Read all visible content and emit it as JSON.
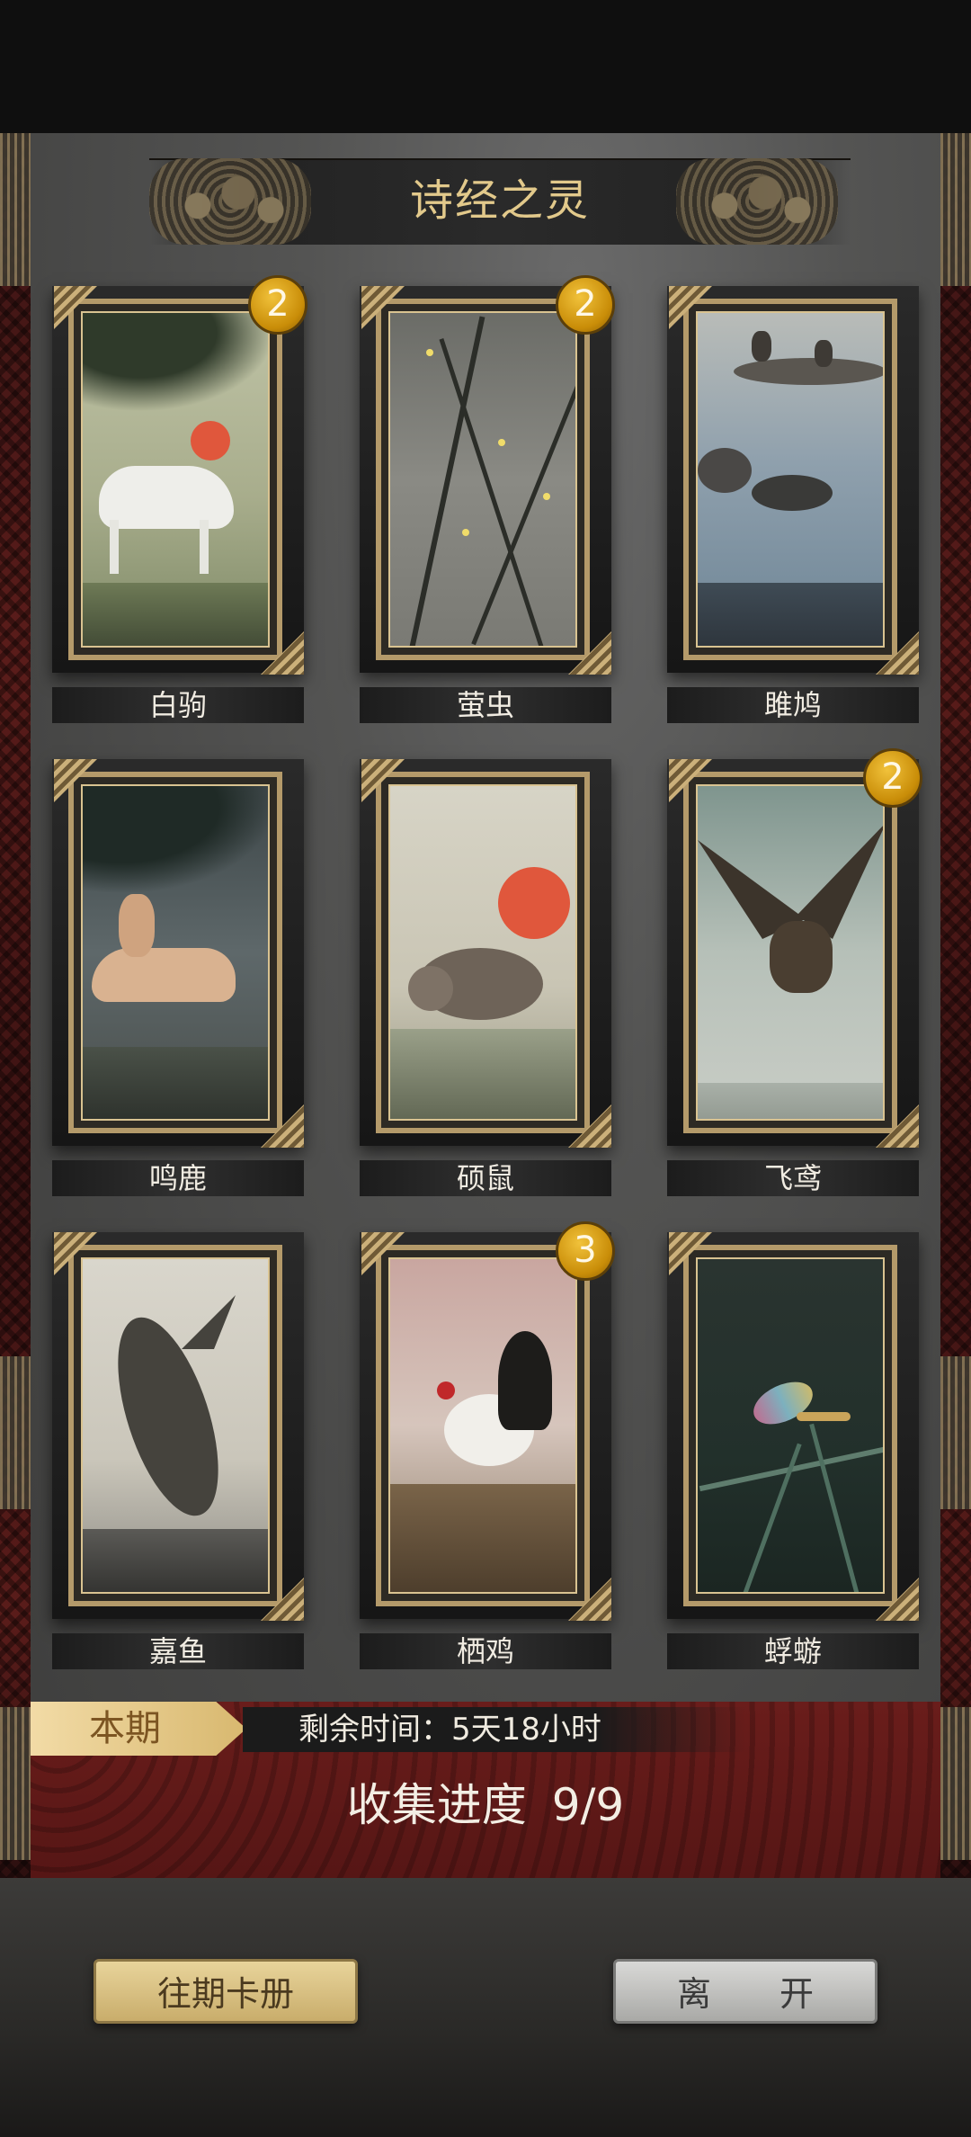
{
  "title": "诗经之灵",
  "cards": [
    {
      "name": "白驹",
      "count": "2"
    },
    {
      "name": "萤虫",
      "count": "2"
    },
    {
      "name": "雎鸠",
      "count": ""
    },
    {
      "name": "鸣鹿",
      "count": ""
    },
    {
      "name": "硕鼠",
      "count": ""
    },
    {
      "name": "飞鸢",
      "count": "2"
    },
    {
      "name": "嘉鱼",
      "count": ""
    },
    {
      "name": "栖鸡",
      "count": "3"
    },
    {
      "name": "蜉蝣",
      "count": ""
    }
  ],
  "status": {
    "period": "本期",
    "time_remaining": "剩余时间：5天18小时",
    "progress_label": "收集进度",
    "progress_value": "9/9"
  },
  "buttons": {
    "history": "往期卡册",
    "leave": "离 开"
  },
  "colors": {
    "gold": "#e2c98b",
    "badge": "#d99b12",
    "band": "#5e1a18"
  }
}
